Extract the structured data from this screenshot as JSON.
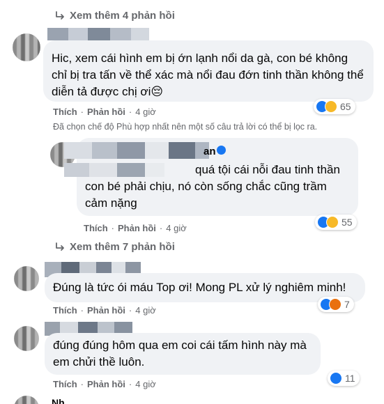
{
  "threads": {
    "view_more_1": "Xem thêm 4 phản hồi",
    "view_more_2": "Xem thêm 7 phản hồi"
  },
  "comments": [
    {
      "text": "Hic, xem cái hình em bị ớn lạnh nổi da gà, con bé không chỉ bị tra tấn về thể xác mà nổi đau đớn tinh thần không thể diễn tả được chị ơi😔",
      "like_label": "Thích",
      "reply_label": "Phản hồi",
      "time": "4 giờ",
      "reaction_count": "65",
      "reactions": [
        "like-icon",
        "sad-icon"
      ]
    },
    {
      "author_suffix": "an",
      "text_line1": "quá tội cái nỗi đau tinh thần",
      "text_line2": "con bé phải chịu, nó còn sống chắc cũng trầm",
      "text_line3": "cảm nặng",
      "like_label": "Thích",
      "reply_label": "Phản hồi",
      "time": "4 giờ",
      "reaction_count": "55",
      "reactions": [
        "like-icon",
        "sad-icon"
      ]
    },
    {
      "text": "Đúng là tức ói máu Top ơi! Mong PL xử lý nghiêm minh!",
      "like_label": "Thích",
      "reply_label": "Phản hồi",
      "time": "4 giờ",
      "reaction_count": "7",
      "reactions": [
        "like-icon",
        "angry-icon"
      ]
    },
    {
      "text": "đúng đúng hôm qua em coi cái tấm hình này mà em chửi thề luôn.",
      "like_label": "Thích",
      "reply_label": "Phản hồi",
      "time": "4 giờ",
      "reaction_count": "11",
      "reactions": [
        "like-icon"
      ]
    }
  ],
  "filter_note": "Đã chọn chế độ Phù hợp nhất nên một số câu trả lời có thể bị lọc ra.",
  "bottom_partial": "Nh... ....",
  "colors": {
    "like": "#1877f2",
    "sad": "#f7b928",
    "angry": "#e9710f",
    "bubble": "#f0f2f5",
    "muted": "#65676b"
  }
}
